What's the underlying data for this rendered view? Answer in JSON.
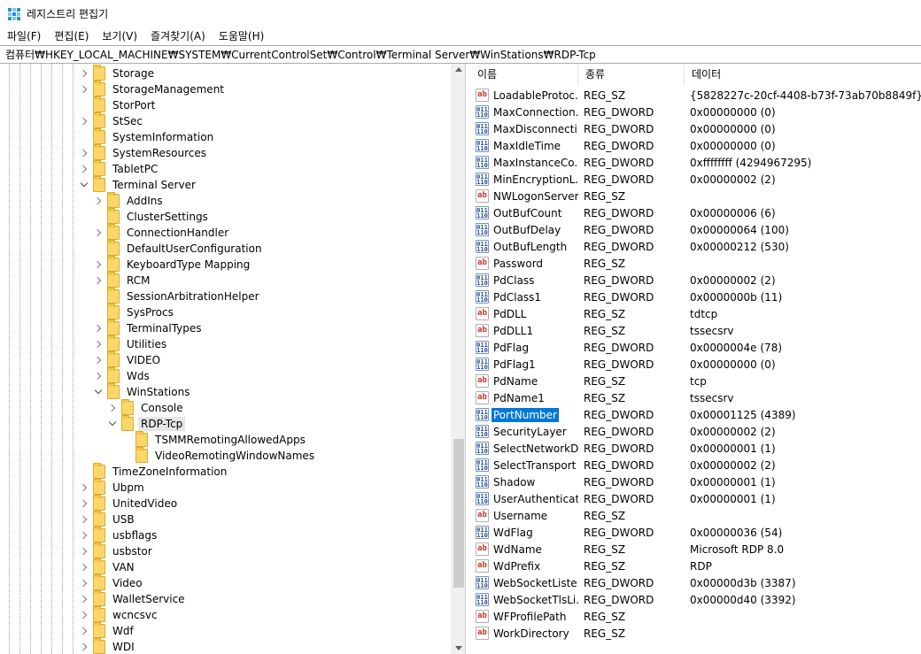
{
  "window": {
    "title": "레지스트리 편집기",
    "accent": "#0078d7"
  },
  "menu": [
    "파일(F)",
    "편집(E)",
    "보기(V)",
    "즐겨찾기(A)",
    "도움말(H)"
  ],
  "address": "컴퓨터₩HKEY_LOCAL_MACHINE₩SYSTEM₩CurrentControlSet₩Control₩Terminal Server₩WinStations₩RDP-Tcp",
  "tree": [
    {
      "label": "Storage",
      "level": 0,
      "state": "closed"
    },
    {
      "label": "StorageManagement",
      "level": 0,
      "state": "closed"
    },
    {
      "label": "StorPort",
      "level": 0,
      "state": "none"
    },
    {
      "label": "StSec",
      "level": 0,
      "state": "closed"
    },
    {
      "label": "SystemInformation",
      "level": 0,
      "state": "none"
    },
    {
      "label": "SystemResources",
      "level": 0,
      "state": "closed"
    },
    {
      "label": "TabletPC",
      "level": 0,
      "state": "closed"
    },
    {
      "label": "Terminal Server",
      "level": 0,
      "state": "open"
    },
    {
      "label": "AddIns",
      "level": 1,
      "state": "closed"
    },
    {
      "label": "ClusterSettings",
      "level": 1,
      "state": "none"
    },
    {
      "label": "ConnectionHandler",
      "level": 1,
      "state": "closed"
    },
    {
      "label": "DefaultUserConfiguration",
      "level": 1,
      "state": "none"
    },
    {
      "label": "KeyboardType Mapping",
      "level": 1,
      "state": "closed"
    },
    {
      "label": "RCM",
      "level": 1,
      "state": "closed"
    },
    {
      "label": "SessionArbitrationHelper",
      "level": 1,
      "state": "none"
    },
    {
      "label": "SysProcs",
      "level": 1,
      "state": "none"
    },
    {
      "label": "TerminalTypes",
      "level": 1,
      "state": "closed"
    },
    {
      "label": "Utilities",
      "level": 1,
      "state": "closed"
    },
    {
      "label": "VIDEO",
      "level": 1,
      "state": "closed"
    },
    {
      "label": "Wds",
      "level": 1,
      "state": "closed"
    },
    {
      "label": "WinStations",
      "level": 1,
      "state": "open"
    },
    {
      "label": "Console",
      "level": 2,
      "state": "closed"
    },
    {
      "label": "RDP-Tcp",
      "level": 2,
      "state": "open",
      "selected": true
    },
    {
      "label": "TSMMRemotingAllowedApps",
      "level": 3,
      "state": "none"
    },
    {
      "label": "VideoRemotingWindowNames",
      "level": 3,
      "state": "none"
    },
    {
      "label": "TimeZoneInformation",
      "level": 0,
      "state": "none"
    },
    {
      "label": "Ubpm",
      "level": 0,
      "state": "closed"
    },
    {
      "label": "UnitedVideo",
      "level": 0,
      "state": "closed"
    },
    {
      "label": "USB",
      "level": 0,
      "state": "closed"
    },
    {
      "label": "usbflags",
      "level": 0,
      "state": "closed"
    },
    {
      "label": "usbstor",
      "level": 0,
      "state": "closed"
    },
    {
      "label": "VAN",
      "level": 0,
      "state": "closed"
    },
    {
      "label": "Video",
      "level": 0,
      "state": "closed"
    },
    {
      "label": "WalletService",
      "level": 0,
      "state": "closed"
    },
    {
      "label": "wcncsvc",
      "level": 0,
      "state": "closed"
    },
    {
      "label": "Wdf",
      "level": 0,
      "state": "closed"
    },
    {
      "label": "WDI",
      "level": 0,
      "state": "closed"
    }
  ],
  "columns": {
    "name": "이름",
    "type": "종류",
    "data": "데이터"
  },
  "values": [
    {
      "name": "LoadableProtoc...",
      "type": "REG_SZ",
      "data": "{5828227c-20cf-4408-b73f-73ab70b8849f}",
      "icon": "ab"
    },
    {
      "name": "MaxConnection...",
      "type": "REG_DWORD",
      "data": "0x00000000 (0)",
      "icon": "dw"
    },
    {
      "name": "MaxDisconnecti...",
      "type": "REG_DWORD",
      "data": "0x00000000 (0)",
      "icon": "dw"
    },
    {
      "name": "MaxIdleTime",
      "type": "REG_DWORD",
      "data": "0x00000000 (0)",
      "icon": "dw"
    },
    {
      "name": "MaxInstanceCo...",
      "type": "REG_DWORD",
      "data": "0xffffffff (4294967295)",
      "icon": "dw"
    },
    {
      "name": "MinEncryptionL...",
      "type": "REG_DWORD",
      "data": "0x00000002 (2)",
      "icon": "dw"
    },
    {
      "name": "NWLogonServer",
      "type": "REG_SZ",
      "data": "",
      "icon": "ab"
    },
    {
      "name": "OutBufCount",
      "type": "REG_DWORD",
      "data": "0x00000006 (6)",
      "icon": "dw"
    },
    {
      "name": "OutBufDelay",
      "type": "REG_DWORD",
      "data": "0x00000064 (100)",
      "icon": "dw"
    },
    {
      "name": "OutBufLength",
      "type": "REG_DWORD",
      "data": "0x00000212 (530)",
      "icon": "dw"
    },
    {
      "name": "Password",
      "type": "REG_SZ",
      "data": "",
      "icon": "ab"
    },
    {
      "name": "PdClass",
      "type": "REG_DWORD",
      "data": "0x00000002 (2)",
      "icon": "dw"
    },
    {
      "name": "PdClass1",
      "type": "REG_DWORD",
      "data": "0x0000000b (11)",
      "icon": "dw"
    },
    {
      "name": "PdDLL",
      "type": "REG_SZ",
      "data": "tdtcp",
      "icon": "ab"
    },
    {
      "name": "PdDLL1",
      "type": "REG_SZ",
      "data": "tssecsrv",
      "icon": "ab"
    },
    {
      "name": "PdFlag",
      "type": "REG_DWORD",
      "data": "0x0000004e (78)",
      "icon": "dw"
    },
    {
      "name": "PdFlag1",
      "type": "REG_DWORD",
      "data": "0x00000000 (0)",
      "icon": "dw"
    },
    {
      "name": "PdName",
      "type": "REG_SZ",
      "data": "tcp",
      "icon": "ab"
    },
    {
      "name": "PdName1",
      "type": "REG_SZ",
      "data": "tssecsrv",
      "icon": "ab"
    },
    {
      "name": "PortNumber",
      "type": "REG_DWORD",
      "data": "0x00001125 (4389)",
      "icon": "dw",
      "selected": true
    },
    {
      "name": "SecurityLayer",
      "type": "REG_DWORD",
      "data": "0x00000002 (2)",
      "icon": "dw"
    },
    {
      "name": "SelectNetworkD...",
      "type": "REG_DWORD",
      "data": "0x00000001 (1)",
      "icon": "dw"
    },
    {
      "name": "SelectTransport",
      "type": "REG_DWORD",
      "data": "0x00000002 (2)",
      "icon": "dw"
    },
    {
      "name": "Shadow",
      "type": "REG_DWORD",
      "data": "0x00000001 (1)",
      "icon": "dw"
    },
    {
      "name": "UserAuthenticat...",
      "type": "REG_DWORD",
      "data": "0x00000001 (1)",
      "icon": "dw"
    },
    {
      "name": "Username",
      "type": "REG_SZ",
      "data": "",
      "icon": "ab"
    },
    {
      "name": "WdFlag",
      "type": "REG_DWORD",
      "data": "0x00000036 (54)",
      "icon": "dw"
    },
    {
      "name": "WdName",
      "type": "REG_SZ",
      "data": "Microsoft RDP 8.0",
      "icon": "ab"
    },
    {
      "name": "WdPrefix",
      "type": "REG_SZ",
      "data": "RDP",
      "icon": "ab"
    },
    {
      "name": "WebSocketListe...",
      "type": "REG_DWORD",
      "data": "0x00000d3b (3387)",
      "icon": "dw"
    },
    {
      "name": "WebSocketTlsLi...",
      "type": "REG_DWORD",
      "data": "0x00000d40 (3392)",
      "icon": "dw"
    },
    {
      "name": "WFProfilePath",
      "type": "REG_SZ",
      "data": "",
      "icon": "ab"
    },
    {
      "name": "WorkDirectory",
      "type": "REG_SZ",
      "data": "",
      "icon": "ab"
    }
  ]
}
